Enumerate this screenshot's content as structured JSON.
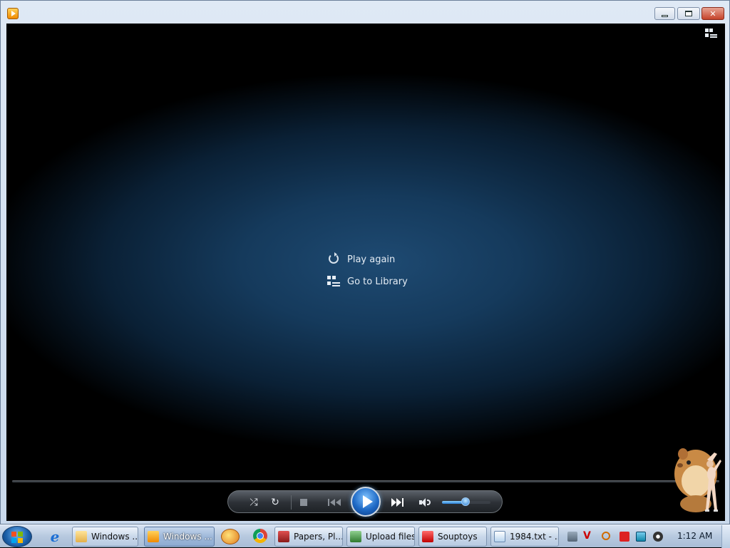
{
  "window": {
    "title": ""
  },
  "player": {
    "end_menu": {
      "play_again": "Play again",
      "go_to_library": "Go to Library"
    },
    "volume_level": 0.48
  },
  "taskbar": {
    "tasks": [
      {
        "label": "Windows ...",
        "active": false
      },
      {
        "label": "Windows ...",
        "active": true
      },
      {
        "label": "Papers, Pl...",
        "active": false
      },
      {
        "label": "Upload files",
        "active": false
      },
      {
        "label": "Souptoys",
        "active": false
      },
      {
        "label": "1984.txt - ...",
        "active": false
      }
    ],
    "clock": "1:12 AM"
  },
  "icons": {
    "app": "media-player-icon",
    "library_toggle": "switch-to-library-icon",
    "play_again": "replay-icon",
    "go_to_library": "library-grid-icon",
    "start": "windows-start-icon"
  },
  "colors": {
    "play_button": "#1f6ac6",
    "taskbar": "#b7c9df",
    "video_glow": "#1e4a72"
  }
}
